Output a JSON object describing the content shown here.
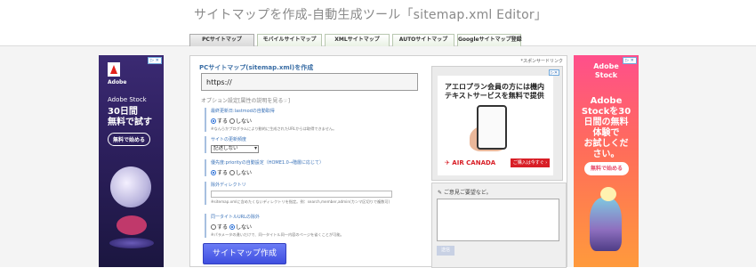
{
  "header": {
    "title": "サイトマップを作成-自動生成ツール「sitemap.xml Editor」"
  },
  "tabs": [
    {
      "label": "PCサイトマップ",
      "active": true
    },
    {
      "label": "モバイルサイトマップ",
      "active": false
    },
    {
      "label": "XMLサイトマップ",
      "active": false
    },
    {
      "label": "AUTOサイトマップ",
      "active": false
    },
    {
      "label": "Googleサイトマップ登録",
      "active": false
    }
  ],
  "left_ad": {
    "brand": "Adobe",
    "product": "Adobe Stock",
    "headline_1": "30日間",
    "headline_2": "無料で試す",
    "button": "無料で始める",
    "control": "▷ ✕"
  },
  "right_ad": {
    "brand_1": "Adobe",
    "brand_2": "Stock",
    "headline_1": "Adobe",
    "headline_2": "Stockを30",
    "headline_3": "日間の無料",
    "headline_4": "体験で",
    "headline_5": "お試しくだ",
    "headline_6": "さい。",
    "button": "無料で始める",
    "control": "▷ ✕"
  },
  "form": {
    "sponsor_label": "*スポンサードリンク",
    "title": "PCサイトマップ(sitemap.xml)を作成",
    "url_value": "https://",
    "options_heading": "オプション設定[属性の説明を見る☞]",
    "lastmod": {
      "title": "最終更新日:lastmodの自動取得",
      "yes": "する",
      "no": "しない",
      "note": "※なんらかプログラムにより動的に生成されたURLからは取得できません。"
    },
    "changefreq": {
      "title": "サイトの更新頻度",
      "selected": "記述しない"
    },
    "priority": {
      "title": "優先度:priorityの自動設定（HOME1.0→階層に応じて）",
      "yes": "する",
      "no": "しない"
    },
    "exclude": {
      "title": "除外ディレクトリ",
      "note": "※sitemap.xmlに含めたくないディレクトリを指定。例：search,member,admin(カンマ区切りで複数可)"
    },
    "dedupe": {
      "title": "同一タイトルURLの除外",
      "yes": "する",
      "no": "しない",
      "note": "※パラメータの違いだけで、同一タイトル同一内容のページを省くことが可能。"
    },
    "generate_button": "サイトマップ作成"
  },
  "inner_ad": {
    "text_1": "アエロプラン会員の方には機内",
    "text_2": "テキストサービスを無料で提供",
    "logo": "✈ AIR CANADA",
    "button": "ご購入は今すぐ ›",
    "control": "▷✕"
  },
  "comments": {
    "title": "✎ ご意見ご要望など。",
    "send_button": "送信"
  },
  "colors": {
    "accent_blue": "#3b73b9",
    "generate_button": "#4a5aea",
    "air_canada_red": "#d81e26"
  }
}
